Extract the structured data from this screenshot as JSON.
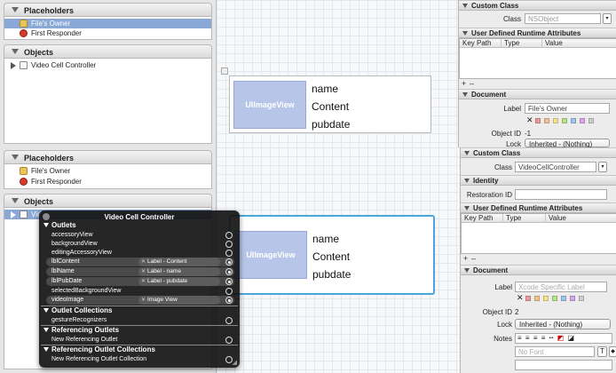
{
  "top": {
    "placeholders_header": "Placeholders",
    "placeholders": [
      {
        "label": "File's Owner",
        "selected": true
      },
      {
        "label": "First Responder",
        "selected": false
      }
    ],
    "objects_header": "Objects",
    "objects": [
      {
        "label": "Video Cell Controller"
      }
    ],
    "cell": {
      "image_view": "UIImageView",
      "labels": [
        "name",
        "Content",
        "pubdate"
      ]
    },
    "inspector": {
      "custom_class_header": "Custom Class",
      "class_label": "Class",
      "class_value": "NSObject",
      "udra_header": "User Defined Runtime Attributes",
      "col_key_path": "Key Path",
      "col_type": "Type",
      "col_value": "Value",
      "plus": "+",
      "minus": "–",
      "document_header": "Document",
      "doc_label_label": "Label",
      "doc_label_value": "File's Owner",
      "object_id_label": "Object ID",
      "object_id_value": "-1",
      "lock_label": "Lock",
      "lock_value": "Inherited - (Nothing)"
    }
  },
  "bottom": {
    "placeholders_header": "Placeholders",
    "placeholders": [
      {
        "label": "File's Owner"
      },
      {
        "label": "First Responder"
      }
    ],
    "objects_header": "Objects",
    "objects": [
      {
        "label": "Vid"
      }
    ],
    "cell": {
      "image_view": "UIImageView",
      "labels": [
        "name",
        "Content",
        "pubdate"
      ]
    },
    "inspector": {
      "custom_class_header": "Custom Class",
      "class_label": "Class",
      "class_value": "VideoCellController",
      "identity_header": "Identity",
      "restoration_id_label": "Restoration ID",
      "udra_header": "User Defined Runtime Attributes",
      "col_key_path": "Key Path",
      "col_type": "Type",
      "col_value": "Value",
      "plus": "+",
      "minus": "–",
      "document_header": "Document",
      "doc_label_label": "Label",
      "doc_label_placeholder": "Xcode Specific Label",
      "object_id_label": "Object ID",
      "object_id_value": "2",
      "lock_label": "Lock",
      "lock_value": "Inherited - (Nothing)",
      "notes_label": "Notes",
      "font_placeholder": "No Font"
    },
    "hud": {
      "title": "Video Cell Controller",
      "sections": [
        {
          "title": "Outlets",
          "rows": [
            {
              "name": "accessoryView",
              "target": ""
            },
            {
              "name": "backgroundView",
              "target": ""
            },
            {
              "name": "editingAccessoryView",
              "target": ""
            },
            {
              "name": "lblContent",
              "target": "Label - Content"
            },
            {
              "name": "lblName",
              "target": "Label - name"
            },
            {
              "name": "lblPubDate",
              "target": "Label - pubdate"
            },
            {
              "name": "selectedBackgroundView",
              "target": ""
            },
            {
              "name": "videoImage",
              "target": "Image View"
            }
          ]
        },
        {
          "title": "Outlet Collections",
          "rows": [
            {
              "name": "gestureRecognizers",
              "target": ""
            }
          ]
        },
        {
          "title": "Referencing Outlets",
          "rows": [
            {
              "name": "New Referencing Outlet",
              "target": ""
            }
          ]
        },
        {
          "title": "Referencing Outlet Collections",
          "rows": [
            {
              "name": "New Referencing Outlet Collection",
              "target": ""
            }
          ]
        }
      ]
    }
  },
  "colors": {
    "selection": "#8aa8d6",
    "accent_selection_border": "#49a6d8",
    "image_view_fill": "#b7c6e8"
  }
}
